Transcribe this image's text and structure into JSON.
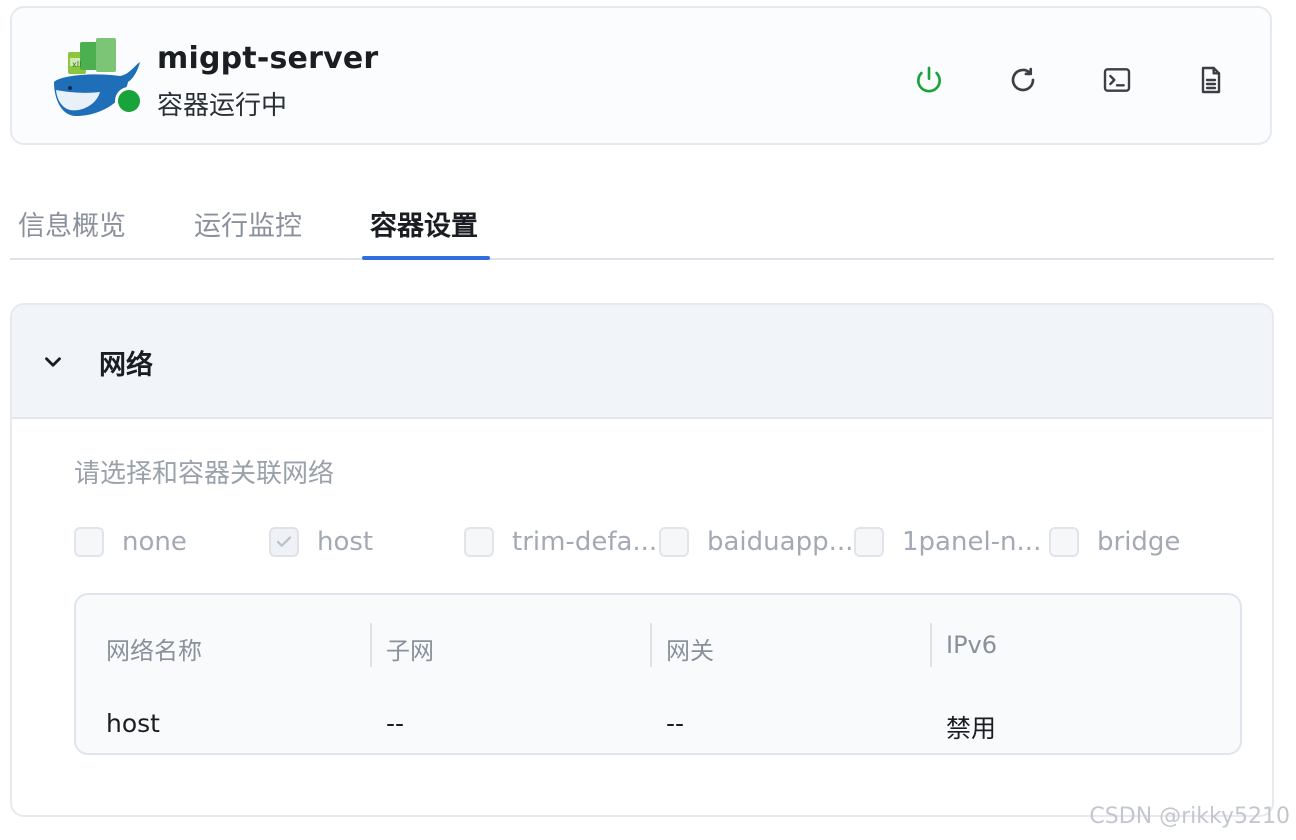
{
  "header": {
    "title": "migpt-server",
    "status_text": "容器运行中",
    "status_color": "#19a33b",
    "actions": [
      {
        "name": "power-icon",
        "color": "#19a33b"
      },
      {
        "name": "restart-icon",
        "color": "#3b3f45"
      },
      {
        "name": "terminal-icon",
        "color": "#3b3f45"
      },
      {
        "name": "log-file-icon",
        "color": "#3b3f45"
      }
    ]
  },
  "tabs": [
    {
      "label": "信息概览",
      "active": false
    },
    {
      "label": "运行监控",
      "active": false
    },
    {
      "label": "容器设置",
      "active": true
    }
  ],
  "network": {
    "title": "网络",
    "hint": "请选择和容器关联网络",
    "options": [
      {
        "label": "none",
        "checked": false
      },
      {
        "label": "host",
        "checked": true
      },
      {
        "label": "trim-defa...",
        "checked": false
      },
      {
        "label": "baiduapp...",
        "checked": false
      },
      {
        "label": "1panel-n...",
        "checked": false
      },
      {
        "label": "bridge",
        "checked": false
      }
    ],
    "table": {
      "columns": [
        "网络名称",
        "子网",
        "网关",
        "IPv6"
      ],
      "rows": [
        [
          "host",
          "--",
          "--",
          "禁用"
        ]
      ]
    }
  },
  "watermark": "CSDN @rikky5210",
  "accent_color": "#2f6fde"
}
